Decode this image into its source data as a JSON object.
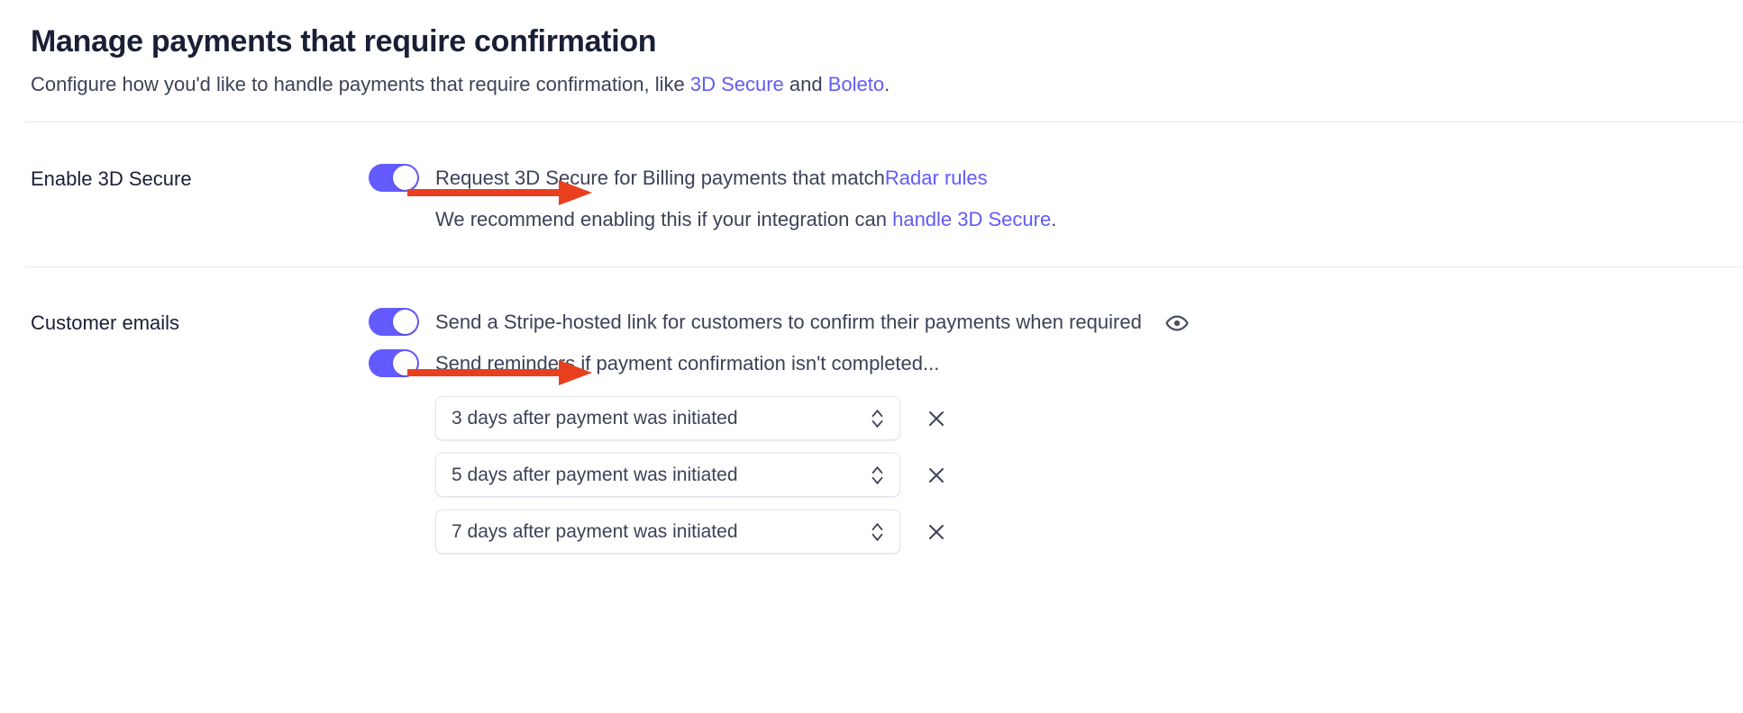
{
  "header": {
    "title": "Manage payments that require confirmation",
    "subtitle_prefix": "Configure how you'd like to handle payments that require confirmation, like ",
    "subtitle_link_1": "3D Secure",
    "subtitle_middle": " and ",
    "subtitle_link_2": "Boleto",
    "subtitle_suffix": "."
  },
  "sections": {
    "three_d_secure": {
      "label": "Enable 3D Secure",
      "toggle": {
        "state": "on",
        "text_prefix": "Request 3D Secure for Billing payments that match ",
        "text_link": "Radar rules"
      },
      "note_prefix": "We recommend enabling this if your integration can ",
      "note_link": "handle 3D Secure",
      "note_suffix": "."
    },
    "customer_emails": {
      "label": "Customer emails",
      "hosted_link_toggle": {
        "state": "on",
        "text": "Send a Stripe-hosted link for customers to confirm their payments when required",
        "preview_icon": "eye-icon"
      },
      "reminders_toggle": {
        "state": "on",
        "text": "Send reminders if payment confirmation isn't completed..."
      },
      "reminders": [
        {
          "value": "3 days after payment was initiated",
          "remove_label": "×"
        },
        {
          "value": "5 days after payment was initiated",
          "remove_label": "×"
        },
        {
          "value": "7 days after payment was initiated",
          "remove_label": "×"
        }
      ]
    }
  },
  "annotations": {
    "arrow_color": "#e8401f",
    "arrows": [
      {
        "name": "arrow-to-3ds-toggle"
      },
      {
        "name": "arrow-to-customer-emails-toggle"
      }
    ]
  },
  "colors": {
    "toggle_on": "#635bff",
    "link": "#625bf6",
    "text": "#3c4257",
    "title": "#1a1f36",
    "divider": "#e6e9ef",
    "select_border": "#e3e8ee"
  }
}
